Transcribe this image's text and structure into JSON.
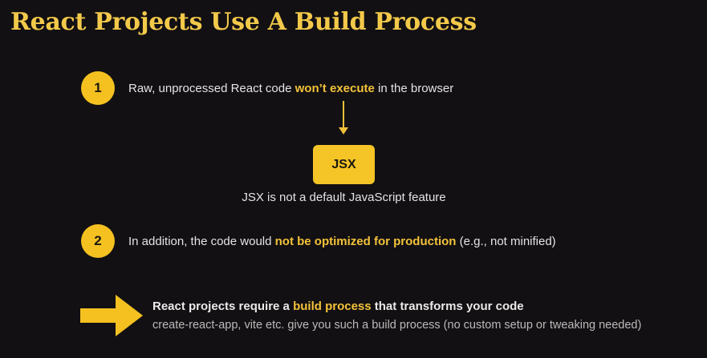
{
  "title": "React Projects Use A Build Process",
  "step1": {
    "number": "1",
    "text_before": "Raw, unprocessed React code ",
    "highlight": "won’t execute",
    "text_after": " in the browser"
  },
  "jsx": {
    "box_label": "JSX",
    "caption": "JSX is not a default JavaScript feature"
  },
  "step2": {
    "number": "2",
    "text_before": "In addition, the code would ",
    "highlight": "not be optimized for production",
    "text_after": " (e.g., not minified)"
  },
  "summary": {
    "main_before": "React projects require a ",
    "main_highlight": "build process",
    "main_after": " that transforms your code",
    "sub": "create-react-app, vite etc. give you such a build process (no custom setup or tweaking needed)"
  },
  "colors": {
    "accent": "#f5c121",
    "background": "#121013"
  }
}
